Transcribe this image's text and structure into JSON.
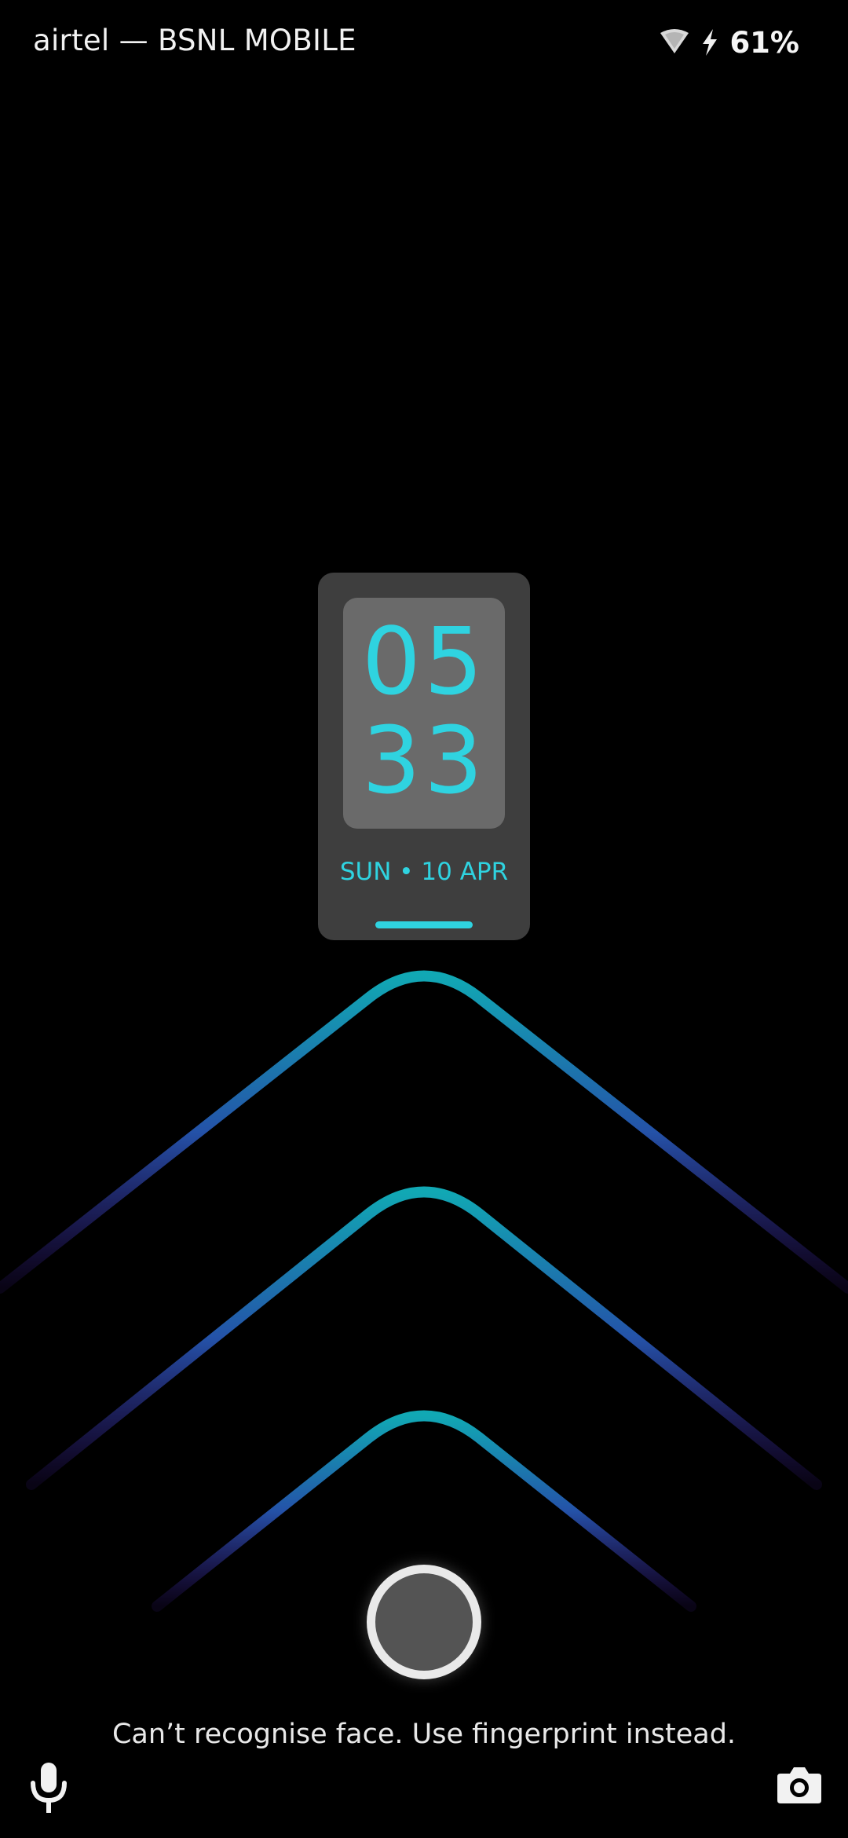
{
  "status_bar": {
    "carrier": "airtel — BSNL MOBILE",
    "battery": "61%",
    "icons": [
      "wifi-icon",
      "charging-icon"
    ]
  },
  "clock": {
    "hours": "05",
    "minutes": "33",
    "date": "SUN • 10 APR",
    "accent_color": "#2fd3e0"
  },
  "lock_screen": {
    "message": "Can’t recognise face. Use fingerprint instead.",
    "left_shortcut_icon": "microphone-icon",
    "right_shortcut_icon": "camera-icon",
    "unlock_icon": "fingerprint-button"
  },
  "wallpaper": {
    "gradient_top": "#11a8b4",
    "gradient_bottom": "#3b1a8c"
  }
}
